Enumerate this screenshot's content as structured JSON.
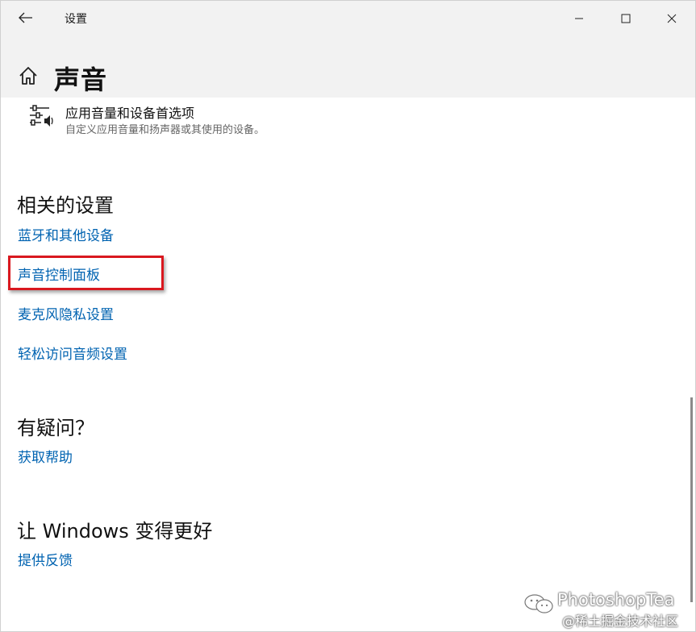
{
  "titlebar": {
    "app_title": "设置"
  },
  "header": {
    "page_title": "声音"
  },
  "setting": {
    "title": "应用音量和设备首选项",
    "description": "自定义应用音量和扬声器或其使用的设备。"
  },
  "related": {
    "title": "相关的设置",
    "links": [
      "蓝牙和其他设备",
      "声音控制面板",
      "麦克风隐私设置",
      "轻松访问音频设置"
    ]
  },
  "help": {
    "title": "有疑问？",
    "link": "获取帮助"
  },
  "feedback": {
    "title": "让 Windows 变得更好",
    "link": "提供反馈"
  },
  "watermark": {
    "line1": "PhotoshopTea",
    "line2": "@稀土掘金技术社区"
  },
  "colors": {
    "link": "#0063b1",
    "highlight": "#d9181f",
    "chrome": "#f2f2f2"
  },
  "icons": [
    "back-arrow-icon",
    "minimize-icon",
    "maximize-icon",
    "close-icon",
    "home-icon",
    "sliders-speaker-icon",
    "wechat-icon"
  ]
}
